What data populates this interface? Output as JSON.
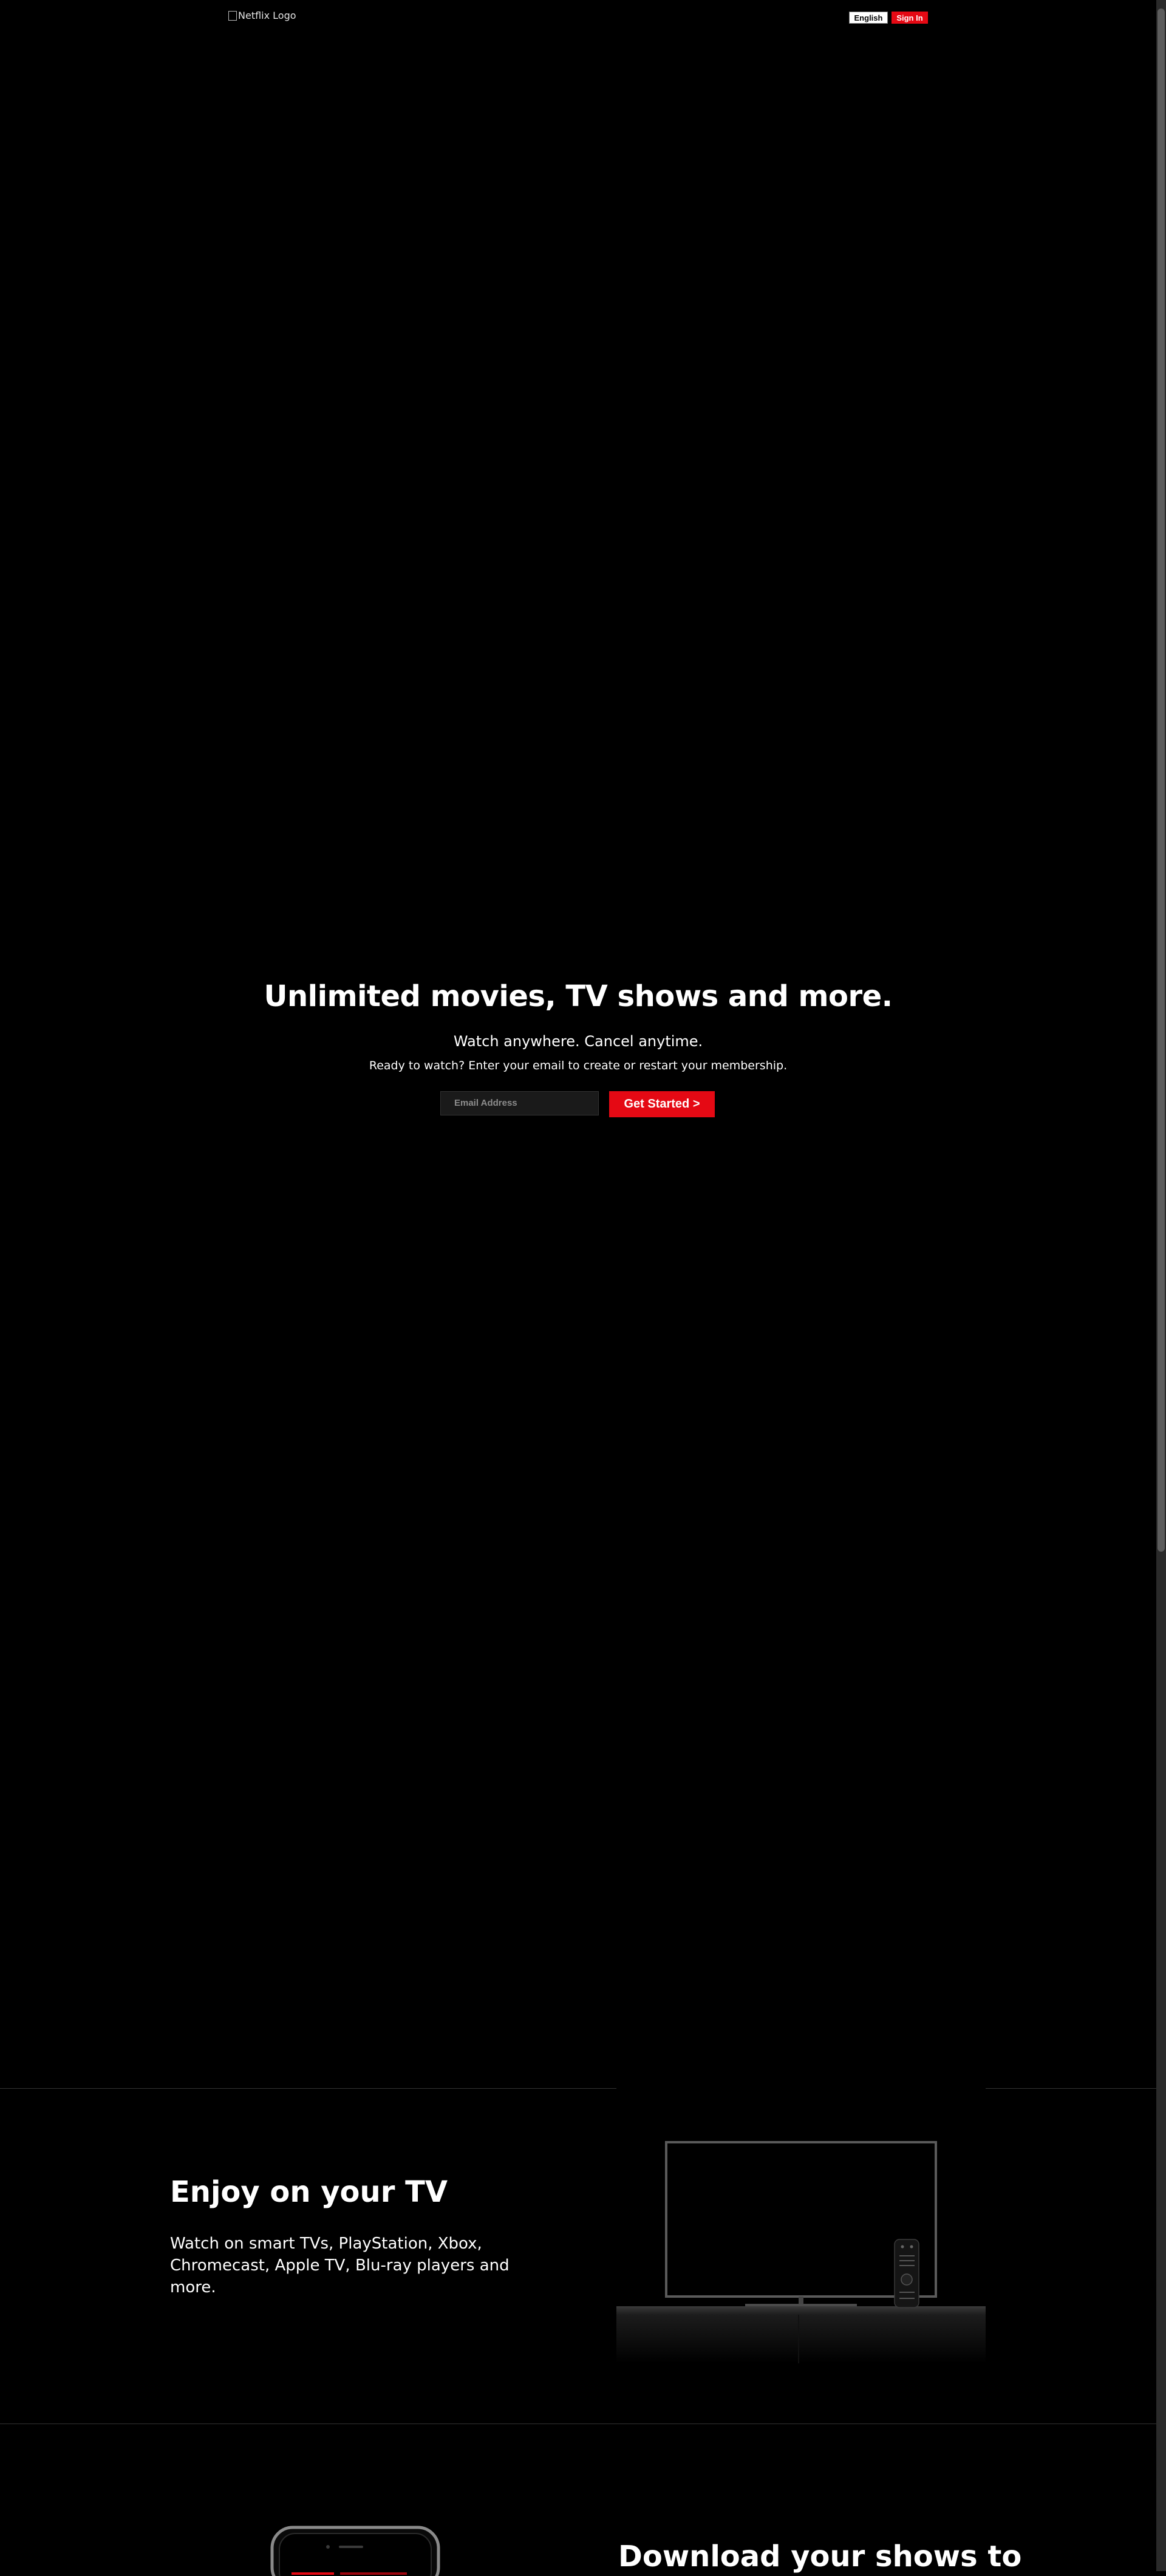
{
  "header": {
    "logo_alt": "Netflix Logo",
    "language_label": "English",
    "signin_label": "Sign In"
  },
  "hero": {
    "title": "Unlimited movies, TV shows and more.",
    "subtitle": "Watch anywhere. Cancel anytime.",
    "cta_text": "Ready to watch? Enter your email to create or restart your membership.",
    "email_placeholder": "Email Address",
    "get_started_label": "Get Started >"
  },
  "tv_section": {
    "title": "Enjoy on your TV",
    "description": "Watch on smart TVs, PlayStation, Xbox, Chromecast, Apple TV, Blu-ray players and more."
  },
  "download_section": {
    "title": "Download your shows to"
  },
  "colors": {
    "brand_red": "#e50914",
    "background": "#000000",
    "divider": "#333333"
  }
}
